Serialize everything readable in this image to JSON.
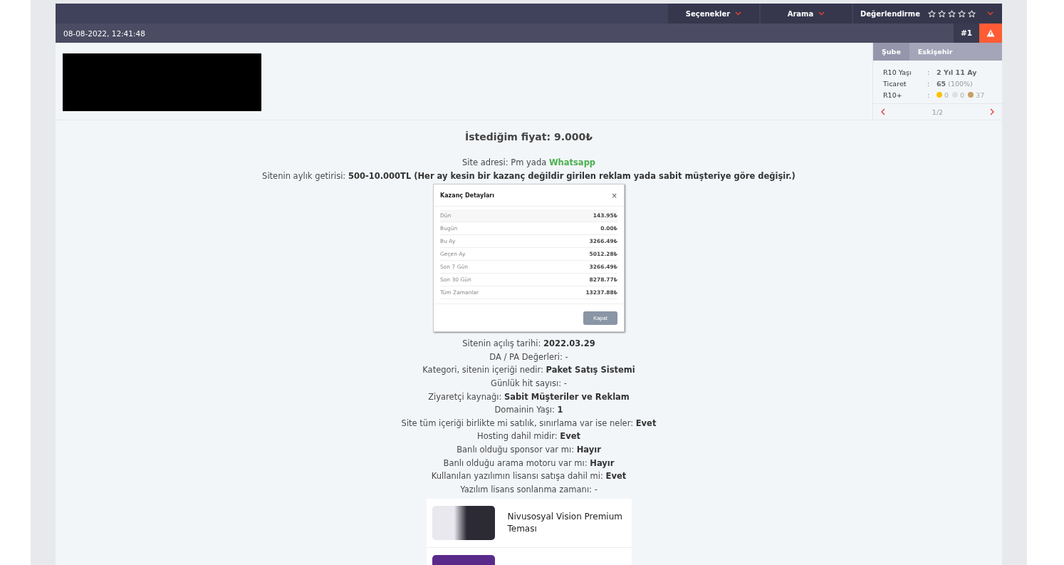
{
  "top_bar": {
    "menus": [
      {
        "label": "Seçenekler"
      },
      {
        "label": "Arama"
      }
    ],
    "rating": {
      "label": "Değerlendirme",
      "stars": 0
    }
  },
  "post_bar": {
    "date": "08-08-2022, 12:41:48",
    "number": "#1"
  },
  "profile": {
    "tabs": [
      {
        "label": "Şube",
        "selected": true
      },
      {
        "label": "Eskişehir",
        "selected": false
      }
    ],
    "stats": [
      {
        "label": "R10 Yaşı",
        "sep": ":",
        "value": "2 Yıl 11 Ay"
      },
      {
        "label": "Ticaret",
        "sep": ":",
        "value": "65",
        "note": "(100%)"
      },
      {
        "label": "R10+",
        "sep": ":",
        "badges": [
          {
            "color": "#ffc107",
            "count": "0"
          },
          {
            "color": "#e0e0e0",
            "count": "0"
          },
          {
            "color": "#c8a060",
            "count": "37"
          }
        ]
      }
    ],
    "pager": "1/2"
  },
  "post": {
    "title": "İstediğim fiyat: 9.000₺",
    "lines_before": [
      [
        {
          "kind": "plain",
          "text": "Site adresi: Pm yada "
        },
        {
          "kind": "link",
          "text": "Whatsapp"
        }
      ],
      [
        {
          "kind": "plain",
          "text": "Sitenin aylık getirisi: "
        },
        {
          "kind": "bold",
          "text": "500-10.000TL (Her ay kesin bir kazanç değildir girilen reklam yada sabit müşteriye göre değişir.)"
        }
      ]
    ],
    "earnings_window": {
      "title": "Kazanç Detayları",
      "close": "×",
      "rows": [
        {
          "label": "Dün",
          "value": "143.95₺"
        },
        {
          "label": "Bugün",
          "value": "0.00₺"
        },
        {
          "label": "Bu Ay",
          "value": "3266.49₺"
        },
        {
          "label": "Geçen Ay",
          "value": "5012.28₺"
        },
        {
          "label": "Son 7 Gün",
          "value": "3266.49₺"
        },
        {
          "label": "Son 30 Gün",
          "value": "8278.77₺"
        },
        {
          "label": "Tüm Zamanlar",
          "value": "13237.88₺"
        }
      ],
      "button": "Kapat"
    },
    "lines_after": [
      [
        {
          "kind": "plain",
          "text": "Sitenin açılış tarihi: "
        },
        {
          "kind": "bold",
          "text": "2022.03.29"
        }
      ],
      [
        {
          "kind": "plain",
          "text": "DA / PA Değerleri: -"
        }
      ],
      [
        {
          "kind": "plain",
          "text": "Kategori, sitenin içeriği nedir: "
        },
        {
          "kind": "bold",
          "text": "Paket Satış Sistemi"
        }
      ],
      [
        {
          "kind": "plain",
          "text": "Günlük hit sayısı: -"
        }
      ],
      [
        {
          "kind": "plain",
          "text": "Ziyaretçi kaynağı: "
        },
        {
          "kind": "bold",
          "text": "Sabit Müşteriler ve Reklam"
        }
      ],
      [
        {
          "kind": "plain",
          "text": "Domainin Yaşı: "
        },
        {
          "kind": "bold",
          "text": "1"
        }
      ],
      [
        {
          "kind": "plain",
          "text": "Site tüm içeriği birlikte mi satılık, sınırlama var ise neler: "
        },
        {
          "kind": "bold",
          "text": "Evet"
        }
      ],
      [
        {
          "kind": "plain",
          "text": "Hosting dahil midir: "
        },
        {
          "kind": "bold",
          "text": "Evet"
        }
      ],
      [
        {
          "kind": "plain",
          "text": "Banlı olduğu sponsor var mı: "
        },
        {
          "kind": "bold",
          "text": "Hayır"
        }
      ],
      [
        {
          "kind": "plain",
          "text": "Banlı olduğu arama motoru var mı: "
        },
        {
          "kind": "bold",
          "text": "Hayır"
        }
      ],
      [
        {
          "kind": "plain",
          "text": "Kullanılan yazılımın lisansı satışa dahil mi: "
        },
        {
          "kind": "bold",
          "text": "Evet"
        }
      ],
      [
        {
          "kind": "plain",
          "text": "Yazılım lisans sonlanma zamanı: -"
        }
      ]
    ],
    "products": [
      {
        "kind": "screenshot",
        "title": "Nivusosyal Vision Premium Teması"
      },
      {
        "kind": "purple"
      }
    ]
  }
}
